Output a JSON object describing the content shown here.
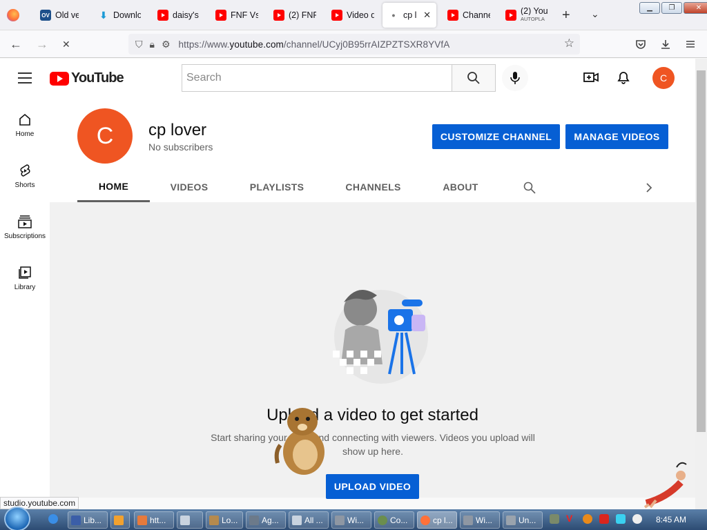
{
  "browser": {
    "tabs": [
      {
        "label": "Old ver",
        "favicon": "OV"
      },
      {
        "label": "Downlo",
        "favicon": "download-icon"
      },
      {
        "label": "daisy's",
        "favicon": "youtube-icon"
      },
      {
        "label": "FNF Vs",
        "favicon": "youtube-icon"
      },
      {
        "label": "(2) FNF",
        "favicon": "youtube-icon"
      },
      {
        "label": "Video d",
        "favicon": "youtube-icon"
      },
      {
        "label": "cp lo",
        "favicon": "loading-icon",
        "active": true
      },
      {
        "label": "Channe",
        "favicon": "youtube-icon"
      },
      {
        "label": "(2) You",
        "sublabel": "AUTOPLA",
        "favicon": "youtube-icon"
      }
    ],
    "url_prefix": "https://www.",
    "url_domain": "youtube.com",
    "url_path": "/channel/UCyj0B95rrAIZPZTSXR8YVfA",
    "status_text": "studio.youtube.com"
  },
  "youtube": {
    "logo_text": "YouTube",
    "search_placeholder": "Search",
    "account_initial": "C",
    "sidebar": [
      {
        "label": "Home",
        "icon": "home-icon"
      },
      {
        "label": "Shorts",
        "icon": "shorts-icon"
      },
      {
        "label": "Subscriptions",
        "icon": "subscriptions-icon"
      },
      {
        "label": "Library",
        "icon": "library-icon"
      }
    ],
    "channel": {
      "avatar_initial": "C",
      "name": "cp lover",
      "subscribers": "No subscribers",
      "customize_label": "CUSTOMIZE CHANNEL",
      "manage_label": "MANAGE VIDEOS",
      "tabs": [
        "HOME",
        "VIDEOS",
        "PLAYLISTS",
        "CHANNELS",
        "ABOUT"
      ],
      "active_tab": "HOME"
    },
    "empty_state": {
      "title": "Upload a video to get started",
      "description": "Start sharing your story and connecting with viewers. Videos you upload will show up here.",
      "upload_label": "UPLOAD VIDEO"
    }
  },
  "taskbar": {
    "items": [
      "Lib...",
      "htt...",
      "Lo...",
      "Ag...",
      "All ...",
      "Wi...",
      "Co...",
      "cp l...",
      "Wi...",
      "Un..."
    ],
    "clock": "8:45 AM"
  },
  "colors": {
    "brand_red": "#ff0000",
    "button_blue": "#065fd4",
    "avatar_orange": "#ef5522"
  }
}
